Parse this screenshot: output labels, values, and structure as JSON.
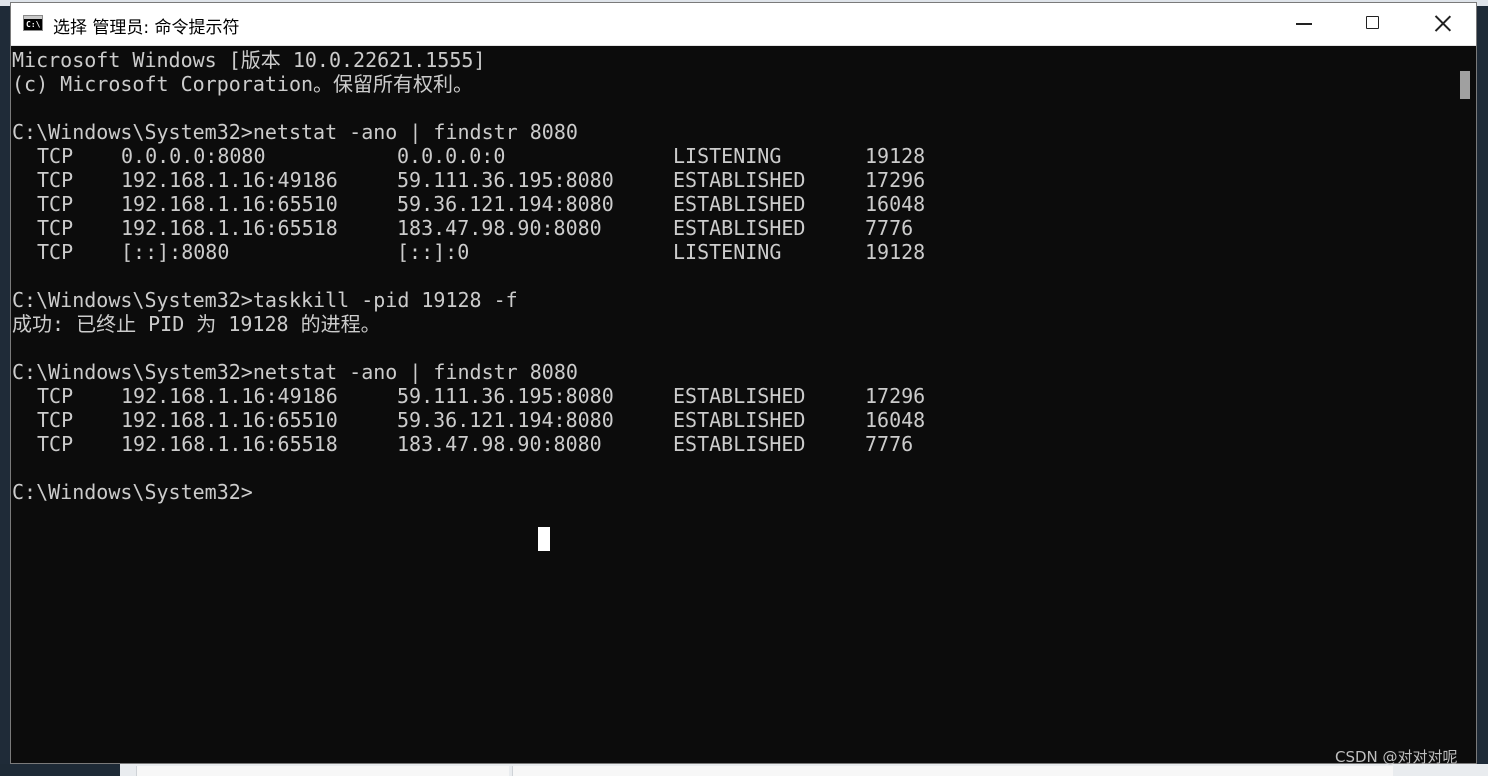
{
  "window": {
    "title": "选择 管理员: 命令提示符",
    "app_icon_text": "C:\\",
    "buttons": {
      "minimize_icon": "minimize-icon",
      "maximize_icon": "maximize-icon",
      "close_icon": "close-icon"
    }
  },
  "console": {
    "header_line1": "Microsoft Windows [版本 10.0.22621.1555]",
    "header_line2": "(c) Microsoft Corporation。保留所有权利。",
    "cmd1": "C:\\Windows\\System32>netstat -ano | findstr 8080",
    "netstat1": [
      {
        "proto": "TCP",
        "local": "0.0.0.0:8080",
        "foreign": "0.0.0.0:0",
        "state": "LISTENING",
        "pid": "19128"
      },
      {
        "proto": "TCP",
        "local": "192.168.1.16:49186",
        "foreign": "59.111.36.195:8080",
        "state": "ESTABLISHED",
        "pid": "17296"
      },
      {
        "proto": "TCP",
        "local": "192.168.1.16:65510",
        "foreign": "59.36.121.194:8080",
        "state": "ESTABLISHED",
        "pid": "16048"
      },
      {
        "proto": "TCP",
        "local": "192.168.1.16:65518",
        "foreign": "183.47.98.90:8080",
        "state": "ESTABLISHED",
        "pid": "7776"
      },
      {
        "proto": "TCP",
        "local": "[::]:8080",
        "foreign": "[::]:0",
        "state": "LISTENING",
        "pid": "19128"
      }
    ],
    "cmd2": "C:\\Windows\\System32>taskkill -pid 19128 -f",
    "taskkill_result": "成功: 已终止 PID 为 19128 的进程。",
    "cmd3": "C:\\Windows\\System32>netstat -ano | findstr 8080",
    "netstat2": [
      {
        "proto": "TCP",
        "local": "192.168.1.16:49186",
        "foreign": "59.111.36.195:8080",
        "state": "ESTABLISHED",
        "pid": "17296"
      },
      {
        "proto": "TCP",
        "local": "192.168.1.16:65510",
        "foreign": "59.36.121.194:8080",
        "state": "ESTABLISHED",
        "pid": "16048"
      },
      {
        "proto": "TCP",
        "local": "192.168.1.16:65518",
        "foreign": "183.47.98.90:8080",
        "state": "ESTABLISHED",
        "pid": "7776"
      }
    ],
    "prompt": "C:\\Windows\\System32>"
  },
  "watermark": "CSDN @对对对呢",
  "colors": {
    "console_bg": "#0c0c0c",
    "console_fg": "#cccccc",
    "titlebar_bg": "#ffffff"
  }
}
